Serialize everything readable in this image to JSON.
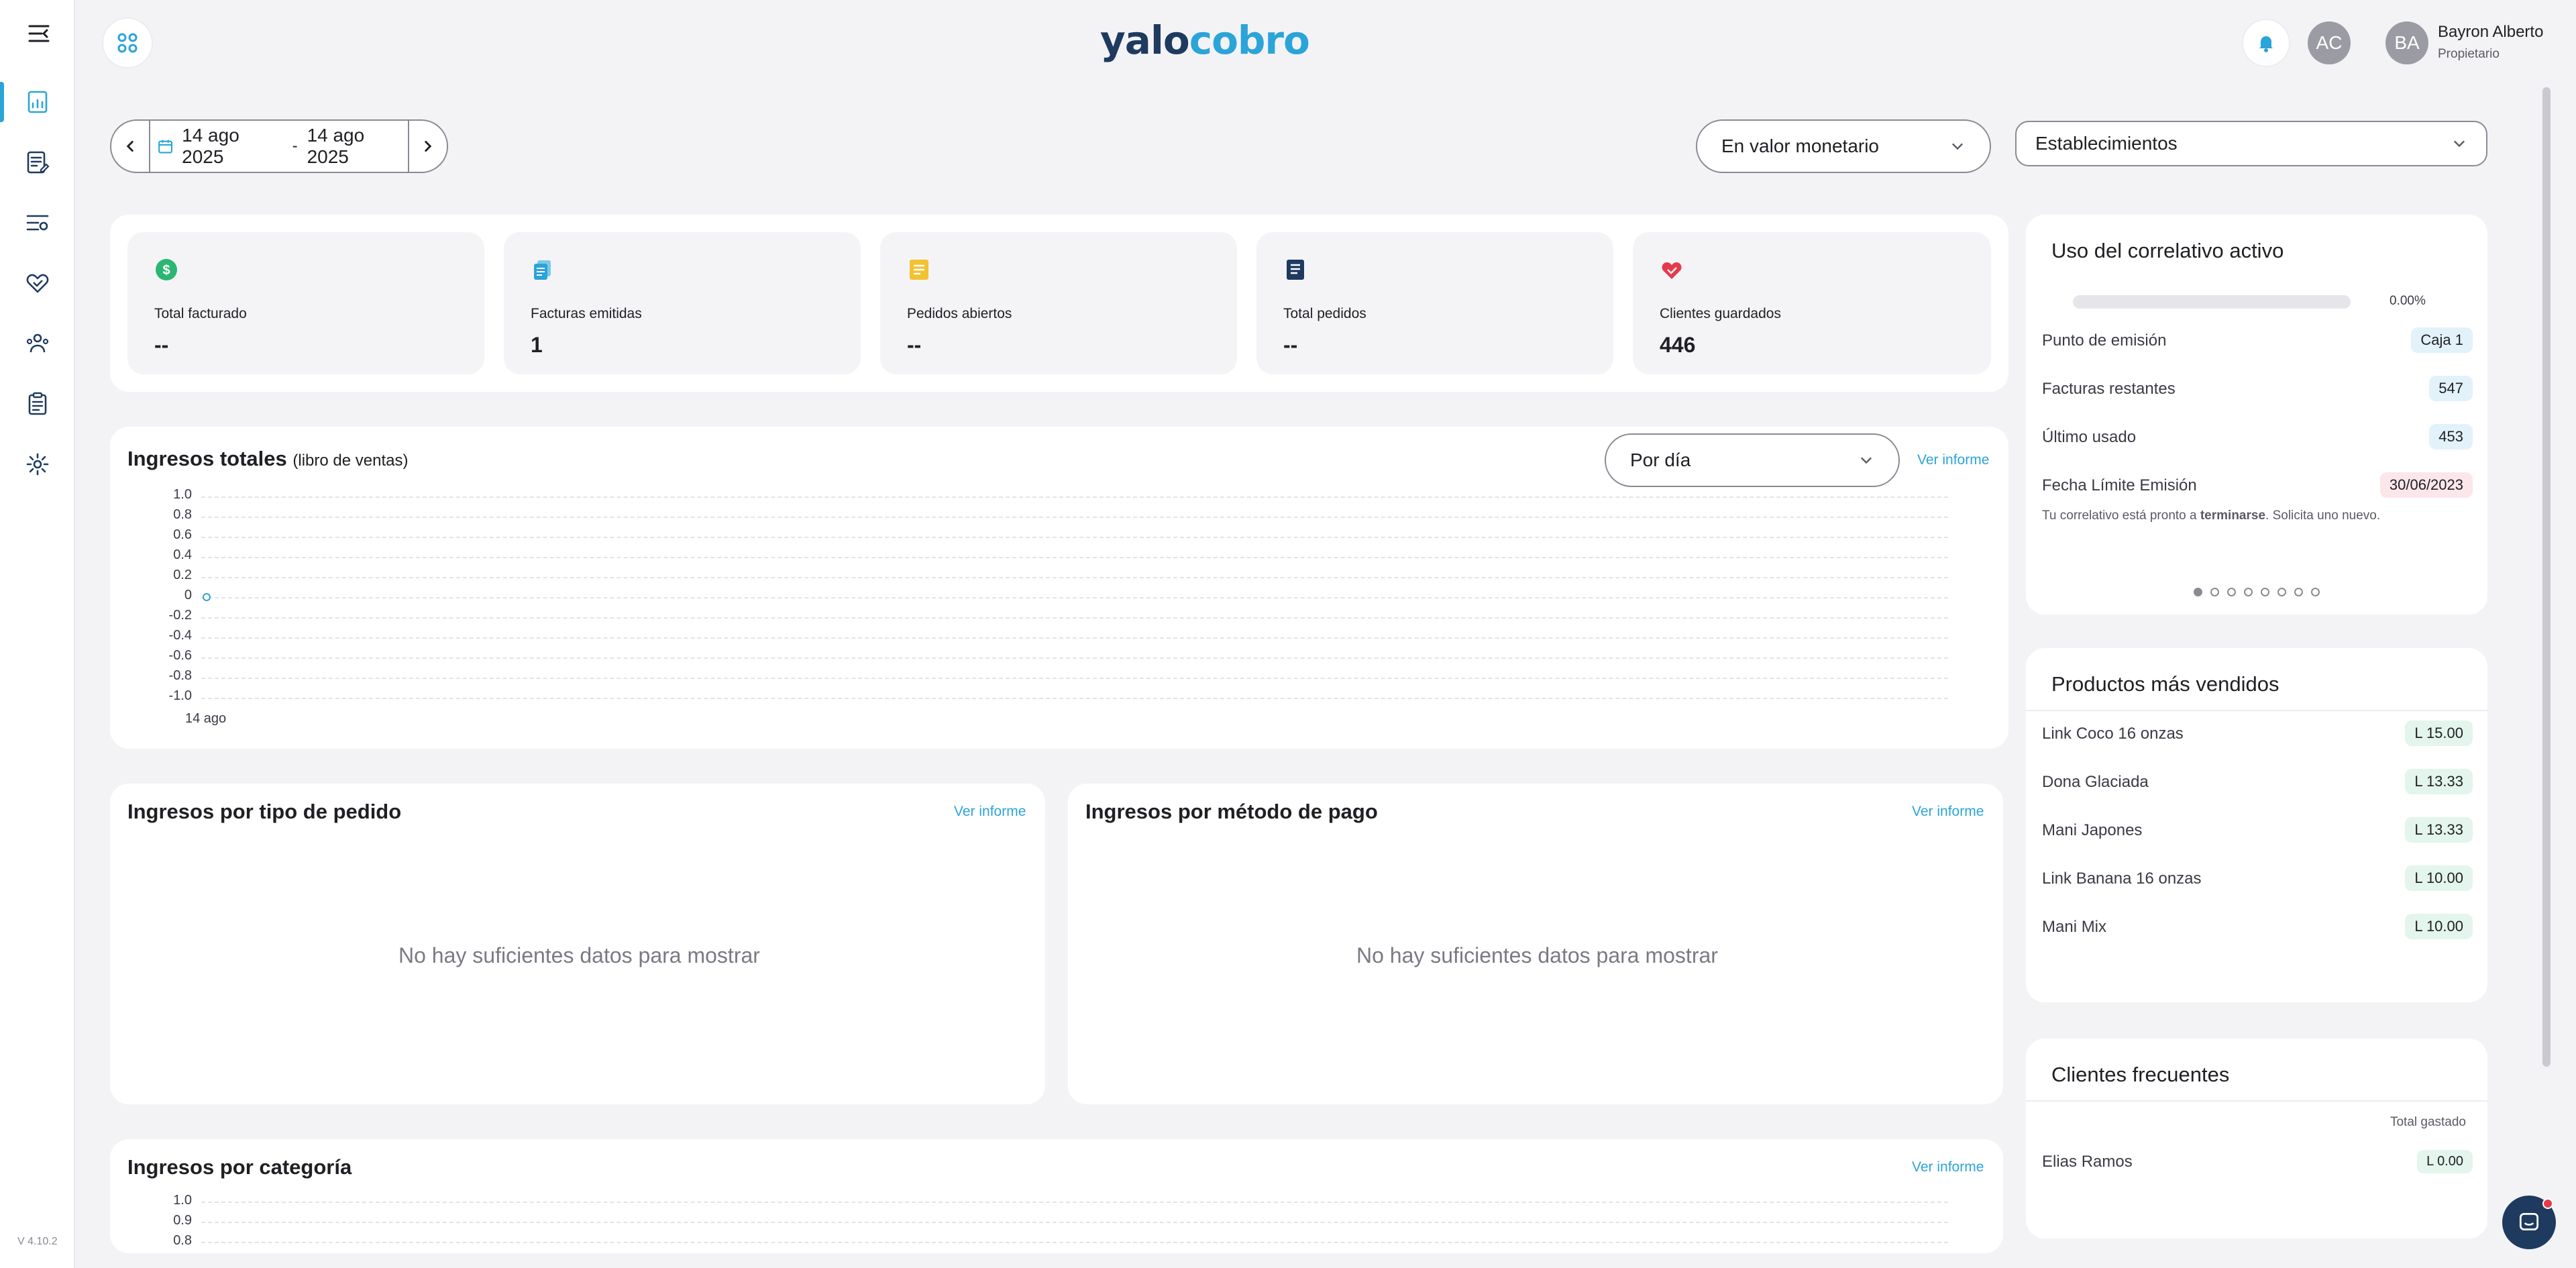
{
  "app": {
    "logo_part1": "yalo",
    "logo_part2": "cobro",
    "version": "V 4.10.2",
    "accent": "#2ba4d8",
    "brand_dark": "#1e3a5f"
  },
  "sidebar": {
    "items": [
      {
        "name": "dashboard",
        "icon": "chart-report-icon",
        "active": true
      },
      {
        "name": "invoices",
        "icon": "document-edit-icon"
      },
      {
        "name": "filters",
        "icon": "list-settings-icon"
      },
      {
        "name": "clients",
        "icon": "heart-handshake-icon"
      },
      {
        "name": "users",
        "icon": "people-group-icon"
      },
      {
        "name": "orders",
        "icon": "clipboard-icon"
      },
      {
        "name": "settings",
        "icon": "gear-icon"
      }
    ]
  },
  "header": {
    "notifications_icon": "bell-icon",
    "avatar_ac": "AC",
    "avatar_ba": "BA",
    "user_name": "Bayron Alberto",
    "user_role": "Propietario"
  },
  "filters": {
    "date_from": "14 ago 2025",
    "date_sep": "-",
    "date_to": "14 ago 2025",
    "value_mode": "En valor monetario",
    "establishments": "Establecimientos"
  },
  "stats": [
    {
      "label": "Total facturado",
      "value": "--",
      "icon": "dollar-circle-icon",
      "color": "#2bb673"
    },
    {
      "label": "Facturas emitidas",
      "value": "1",
      "icon": "documents-icon",
      "color": "#2ba4d8"
    },
    {
      "label": "Pedidos abiertos",
      "value": "--",
      "icon": "note-icon",
      "color": "#f2c230"
    },
    {
      "label": "Total pedidos",
      "value": "--",
      "icon": "list-doc-icon",
      "color": "#1e3a5f"
    },
    {
      "label": "Clientes guardados",
      "value": "446",
      "icon": "heart-hand-icon",
      "color": "#e53a4a"
    }
  ],
  "revenue": {
    "title": "Ingresos totales",
    "subtitle": "(libro de ventas)",
    "period": "Por día",
    "link": "Ver informe",
    "chart_data": {
      "type": "line",
      "x": [
        "14 ago"
      ],
      "series": [
        {
          "values": [
            0
          ]
        }
      ],
      "ylim": [
        -1.0,
        1.0
      ],
      "yticks": [
        "1.0",
        "0.8",
        "0.6",
        "0.4",
        "0.2",
        "0",
        "-0.2",
        "-0.4",
        "-0.6",
        "-0.8",
        "-1.0"
      ],
      "grid": true
    }
  },
  "by_order_type": {
    "title": "Ingresos por tipo de pedido",
    "link": "Ver informe",
    "empty": "No hay suficientes datos para mostrar"
  },
  "by_payment": {
    "title": "Ingresos por método de pago",
    "link": "Ver informe",
    "empty": "No hay suficientes datos para mostrar"
  },
  "by_category": {
    "title": "Ingresos por categoría",
    "link": "Ver informe",
    "yticks": [
      "1.0",
      "0.9",
      "0.8"
    ]
  },
  "correlativo": {
    "title": "Uso del correlativo activo",
    "progress_label": "0.00%",
    "progress": 0,
    "rows": [
      {
        "label": "Punto de emisión",
        "value": "Caja 1"
      },
      {
        "label": "Facturas restantes",
        "value": "547"
      },
      {
        "label": "Último usado",
        "value": "453"
      },
      {
        "label": "Fecha Límite Emisión",
        "value": "30/06/2023"
      }
    ],
    "note_pre": "Tu correlativo está pronto a ",
    "note_bold": "terminarse",
    "note_post": ". Solicita uno nuevo.",
    "dots": 8
  },
  "top_products": {
    "title": "Productos más vendidos",
    "items": [
      {
        "name": "Link Coco 16 onzas",
        "value": "L 15.00"
      },
      {
        "name": "Dona Glaciada",
        "value": "L 13.33"
      },
      {
        "name": "Mani Japones",
        "value": "L 13.33"
      },
      {
        "name": "Link Banana 16 onzas",
        "value": "L 10.00"
      },
      {
        "name": "Mani Mix",
        "value": "L 10.00"
      }
    ]
  },
  "frequent_clients": {
    "title": "Clientes frecuentes",
    "column": "Total gastado",
    "items": [
      {
        "name": "Elias Ramos",
        "value": "L 0.00"
      }
    ]
  }
}
